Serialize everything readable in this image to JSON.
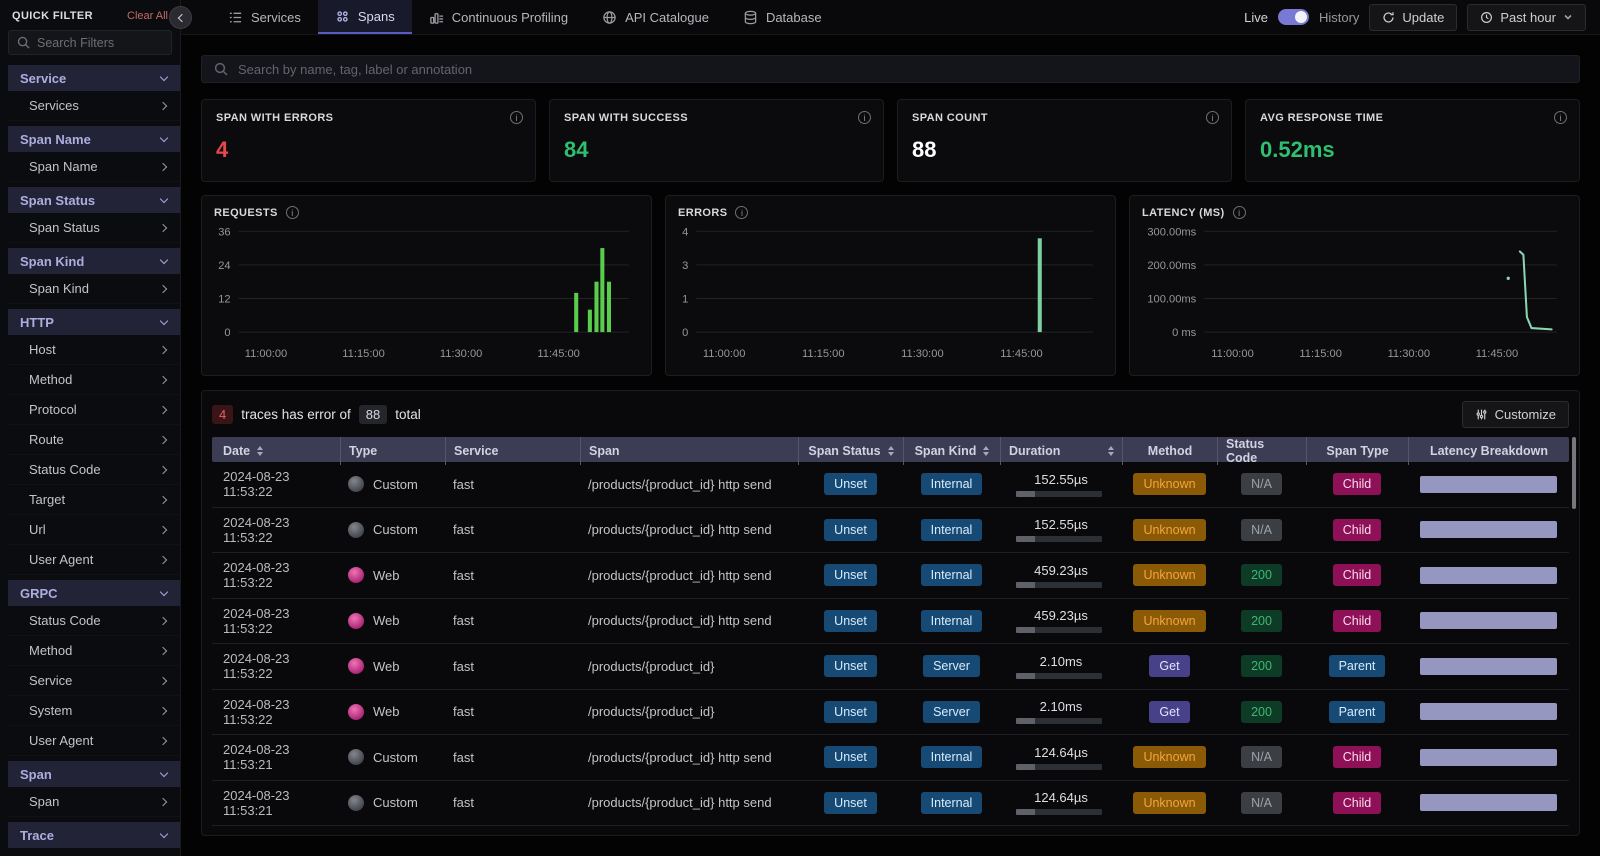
{
  "sidebar": {
    "title": "QUICK FILTER",
    "clear_all": "Clear All",
    "search_placeholder": "Search Filters",
    "items": [
      {
        "label": "Service",
        "type": "header"
      },
      {
        "label": "Services",
        "type": "child"
      },
      {
        "label": "Span Name",
        "type": "header"
      },
      {
        "label": "Span Name",
        "type": "child"
      },
      {
        "label": "Span Status",
        "type": "header"
      },
      {
        "label": "Span Status",
        "type": "child"
      },
      {
        "label": "Span Kind",
        "type": "header"
      },
      {
        "label": "Span Kind",
        "type": "child"
      },
      {
        "label": "HTTP",
        "type": "header"
      },
      {
        "label": "Host",
        "type": "child"
      },
      {
        "label": "Method",
        "type": "child"
      },
      {
        "label": "Protocol",
        "type": "child"
      },
      {
        "label": "Route",
        "type": "child"
      },
      {
        "label": "Status Code",
        "type": "child"
      },
      {
        "label": "Target",
        "type": "child"
      },
      {
        "label": "Url",
        "type": "child"
      },
      {
        "label": "User Agent",
        "type": "child"
      },
      {
        "label": "GRPC",
        "type": "header"
      },
      {
        "label": "Status Code",
        "type": "child"
      },
      {
        "label": "Method",
        "type": "child"
      },
      {
        "label": "Service",
        "type": "child"
      },
      {
        "label": "System",
        "type": "child"
      },
      {
        "label": "User Agent",
        "type": "child"
      },
      {
        "label": "Span",
        "type": "header"
      },
      {
        "label": "Span",
        "type": "child"
      },
      {
        "label": "Trace",
        "type": "header"
      }
    ]
  },
  "navbar": {
    "tabs": [
      {
        "label": "Services"
      },
      {
        "label": "Spans"
      },
      {
        "label": "Continuous Profiling"
      },
      {
        "label": "API Catalogue"
      },
      {
        "label": "Database"
      }
    ],
    "live_label": "Live",
    "history_label": "History",
    "update_label": "Update",
    "time_range": "Past hour"
  },
  "search": {
    "placeholder": "Search by name, tag, label or annotation"
  },
  "metric_cards": [
    {
      "title": "SPAN WITH ERRORS",
      "value": "4",
      "color": "#e5484d"
    },
    {
      "title": "SPAN WITH SUCCESS",
      "value": "84",
      "color": "#2fbf71"
    },
    {
      "title": "SPAN COUNT",
      "value": "88",
      "color": "#ffffff"
    },
    {
      "title": "AVG RESPONSE TIME",
      "value": "0.52ms",
      "color": "#2fbf71"
    }
  ],
  "chart_data": [
    {
      "type": "bar",
      "title": "REQUESTS",
      "yticks": [
        "0",
        "12",
        "24",
        "36"
      ],
      "ymax": 36,
      "ylim": [
        0,
        36
      ],
      "grid": true,
      "color": "#5bcd4c",
      "xticks": [
        {
          "pos": 0.07,
          "label": "11:00:00"
        },
        {
          "pos": 0.32,
          "label": "11:15:00"
        },
        {
          "pos": 0.57,
          "label": "11:30:00"
        },
        {
          "pos": 0.82,
          "label": "11:45:00"
        }
      ],
      "bars": [
        {
          "time": "11:46:00",
          "pos": 0.865,
          "value": 14
        },
        {
          "time": "11:47:30",
          "pos": 0.9,
          "value": 8
        },
        {
          "time": "11:48:00",
          "pos": 0.917,
          "value": 18
        },
        {
          "time": "11:48:30",
          "pos": 0.932,
          "value": 30
        },
        {
          "time": "11:49:00",
          "pos": 0.949,
          "value": 18
        }
      ]
    },
    {
      "type": "bar",
      "title": "ERRORS",
      "yticks": [
        "0",
        "1",
        "3",
        "4"
      ],
      "ymax": 4.3,
      "ylim": [
        0,
        4
      ],
      "grid": true,
      "color": "#7fd0a0",
      "xticks": [
        {
          "pos": 0.07,
          "label": "11:00:00"
        },
        {
          "pos": 0.32,
          "label": "11:15:00"
        },
        {
          "pos": 0.57,
          "label": "11:30:00"
        },
        {
          "pos": 0.82,
          "label": "11:45:00"
        }
      ],
      "bars": [
        {
          "time": "11:46:30",
          "pos": 0.866,
          "value": 4
        }
      ]
    },
    {
      "type": "line",
      "title": "LATENCY (MS)",
      "yticks": [
        "0 ms",
        "100.00ms",
        "200.00ms",
        "300.00ms"
      ],
      "ymax": 300,
      "ylim": [
        0,
        300
      ],
      "grid": true,
      "color": "#8ad6b4",
      "xticks": [
        {
          "pos": 0.08,
          "label": "11:00:00"
        },
        {
          "pos": 0.33,
          "label": "11:15:00"
        },
        {
          "pos": 0.58,
          "label": "11:30:00"
        },
        {
          "pos": 0.83,
          "label": "11:45:00"
        }
      ],
      "points": [
        {
          "time": "11:47:00",
          "pos": 0.895,
          "value": 240
        },
        {
          "time": "11:47:15",
          "pos": 0.905,
          "value": 230
        },
        {
          "time": "11:47:45",
          "pos": 0.915,
          "value": 45
        },
        {
          "time": "11:48:15",
          "pos": 0.928,
          "value": 12
        },
        {
          "time": "11:50:00",
          "pos": 0.985,
          "value": 8
        }
      ],
      "dots": [
        {
          "time": "11:43:00",
          "pos": 0.862,
          "value": 160
        }
      ]
    }
  ],
  "table": {
    "error_count": "4",
    "error_text": "traces has error of",
    "total_count": "88",
    "total_text": "total",
    "customize_label": "Customize",
    "columns": [
      "Date",
      "Type",
      "Service",
      "Span",
      "Span Status",
      "Span Kind",
      "Duration",
      "Method",
      "Status Code",
      "Span Type",
      "Latency Breakdown"
    ],
    "rows": [
      {
        "date": "2024-08-23 11:53:22",
        "type": "Custom",
        "service": "fast",
        "span": "/products/{product_id} http send",
        "span_status": "Unset",
        "span_kind": "Internal",
        "duration": "152.55µs",
        "method": "Unknown",
        "status_code": "N/A",
        "span_type": "Child"
      },
      {
        "date": "2024-08-23 11:53:22",
        "type": "Custom",
        "service": "fast",
        "span": "/products/{product_id} http send",
        "span_status": "Unset",
        "span_kind": "Internal",
        "duration": "152.55µs",
        "method": "Unknown",
        "status_code": "N/A",
        "span_type": "Child"
      },
      {
        "date": "2024-08-23 11:53:22",
        "type": "Web",
        "service": "fast",
        "span": "/products/{product_id} http send",
        "span_status": "Unset",
        "span_kind": "Internal",
        "duration": "459.23µs",
        "method": "Unknown",
        "status_code": "200",
        "span_type": "Child"
      },
      {
        "date": "2024-08-23 11:53:22",
        "type": "Web",
        "service": "fast",
        "span": "/products/{product_id} http send",
        "span_status": "Unset",
        "span_kind": "Internal",
        "duration": "459.23µs",
        "method": "Unknown",
        "status_code": "200",
        "span_type": "Child"
      },
      {
        "date": "2024-08-23 11:53:22",
        "type": "Web",
        "service": "fast",
        "span": "/products/{product_id}",
        "span_status": "Unset",
        "span_kind": "Server",
        "duration": "2.10ms",
        "method": "Get",
        "status_code": "200",
        "span_type": "Parent"
      },
      {
        "date": "2024-08-23 11:53:22",
        "type": "Web",
        "service": "fast",
        "span": "/products/{product_id}",
        "span_status": "Unset",
        "span_kind": "Server",
        "duration": "2.10ms",
        "method": "Get",
        "status_code": "200",
        "span_type": "Parent"
      },
      {
        "date": "2024-08-23 11:53:21",
        "type": "Custom",
        "service": "fast",
        "span": "/products/{product_id} http send",
        "span_status": "Unset",
        "span_kind": "Internal",
        "duration": "124.64µs",
        "method": "Unknown",
        "status_code": "N/A",
        "span_type": "Child"
      },
      {
        "date": "2024-08-23 11:53:21",
        "type": "Custom",
        "service": "fast",
        "span": "/products/{product_id} http send",
        "span_status": "Unset",
        "span_kind": "Internal",
        "duration": "124.64µs",
        "method": "Unknown",
        "status_code": "N/A",
        "span_type": "Child"
      }
    ]
  }
}
